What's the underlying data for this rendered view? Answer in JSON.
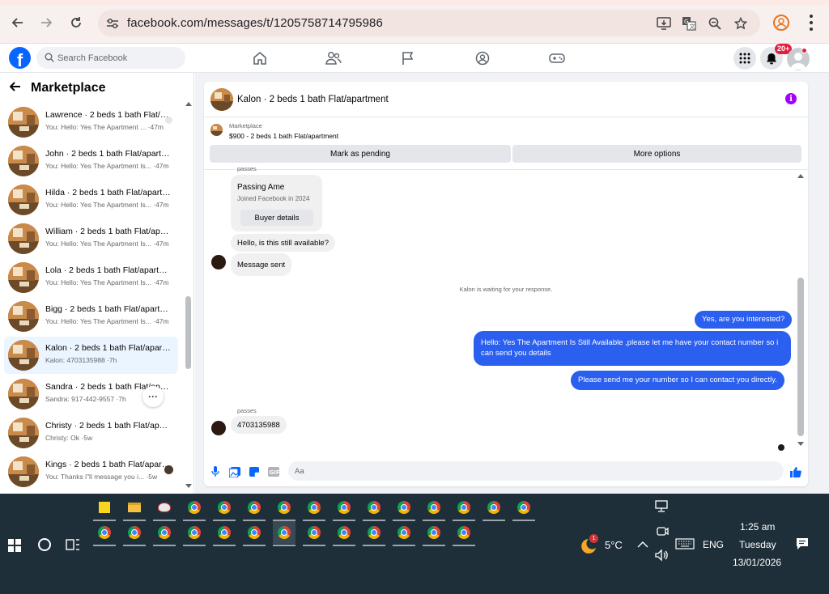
{
  "browser": {
    "url": "facebook.com/messages/t/1205758714795986",
    "icons": [
      "back-arrow-icon",
      "forward-arrow-icon",
      "reload-icon",
      "site-settings-icon",
      "install-app-icon",
      "translate-icon",
      "zoom-icon",
      "bookmark-star-icon",
      "profile-icon",
      "more-menu-icon"
    ]
  },
  "fb_header": {
    "logo": "f",
    "search_placeholder": "Search Facebook",
    "notification_count": "20+"
  },
  "sidebar": {
    "title": "Marketplace",
    "conversations": [
      {
        "name": "Lawrence · 2 beds 1 bath Flat/apartment",
        "snippet": "You: Hello: Yes The Apartment ... ·47m",
        "active": false
      },
      {
        "name": "John · 2 beds 1 bath Flat/apartment",
        "snippet": "You: Hello: Yes The Apartment Is... ·47m",
        "active": false
      },
      {
        "name": "Hilda · 2 beds 1 bath Flat/apartment",
        "snippet": "You: Hello: Yes The Apartment Is... ·47m",
        "active": false
      },
      {
        "name": "William · 2 beds 1 bath Flat/apartment",
        "snippet": "You: Hello: Yes The Apartment Is... ·47m",
        "active": false
      },
      {
        "name": "Lola · 2 beds 1 bath Flat/apartment",
        "snippet": "You: Hello: Yes The Apartment Is... ·47m",
        "active": false
      },
      {
        "name": "Bigg · 2 beds 1 bath Flat/apartment",
        "snippet": "You: Hello: Yes The Apartment Is... ·47m",
        "active": false
      },
      {
        "name": "Kalon · 2 beds 1 bath Flat/apartment",
        "snippet": "Kalon: 4703135988 ·7h",
        "active": true
      },
      {
        "name": "Sandra · 2 beds 1 bath Flat/apartment",
        "snippet": "Sandra: 917-442-9557 ·7h",
        "active": false
      },
      {
        "name": "Christy · 2 beds 1 bath Flat/apartment",
        "snippet": "Christy: Ok ·5w",
        "active": false
      },
      {
        "name": "Kings · 2 beds 1 bath Flat/apartment",
        "snippet": "You: Thanks i\"ll message you i... ·5w",
        "active": false
      }
    ],
    "more_label": "···"
  },
  "chat": {
    "title": "Kalon · 2 beds 1 bath Flat/apartment",
    "info_icon": "i",
    "marketplace_label": "Marketplace",
    "listing": "$900 - 2 beds 1 bath Flat/apartment",
    "mark_pending_label": "Mark as pending",
    "more_options_label": "More options",
    "sender_label_top": "passes",
    "buyer_card": {
      "name": "Passing Ame",
      "subtitle": "Joined Facebook in 2024",
      "button": "Buyer details"
    },
    "incoming_1": "Hello, is this still available?",
    "incoming_2": "Message sent",
    "waiting_text": "Kalon is waiting for your response.",
    "outgoing": [
      "Yes, are you interested?",
      "Hello: Yes The Apartment Is Still Available ,please let me have your contact number so i can send you details",
      "Please send me your number so I can contact you directly."
    ],
    "sender_label_bottom": "passes",
    "incoming_3": "4703135988",
    "composer_placeholder": "Aa",
    "composer_icons": [
      "microphone-icon",
      "photo-icon",
      "sticker-icon",
      "gif-icon",
      "emoji-icon",
      "thumbs-up-icon"
    ],
    "gif_label": "GIF"
  },
  "taskbar": {
    "weather_temp": "5°C",
    "weather_badge": "1",
    "language": "ENG",
    "time": "1:25 am",
    "day": "Tuesday",
    "date": "13/01/2026"
  }
}
